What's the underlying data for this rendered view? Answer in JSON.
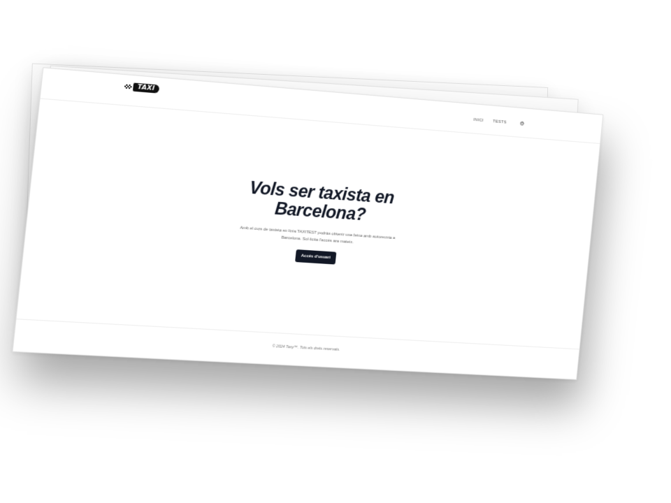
{
  "header": {
    "logo_text": "TAXI",
    "nav": [
      {
        "label": "INICI"
      },
      {
        "label": "TESTS"
      }
    ],
    "settings_icon": "gear-icon"
  },
  "hero": {
    "title": "Vols ser taxista en Barcelona?",
    "description": "Amb el curs de taxista en línia TAXITEST podràs obtenir una feina amb autonomia a Barcelona. Sol·licita l'accés ara mateix.",
    "cta_label": "Accés d'usuari"
  },
  "footer": {
    "text": "© 2024 Taxy™. Tots els drets reservats."
  }
}
